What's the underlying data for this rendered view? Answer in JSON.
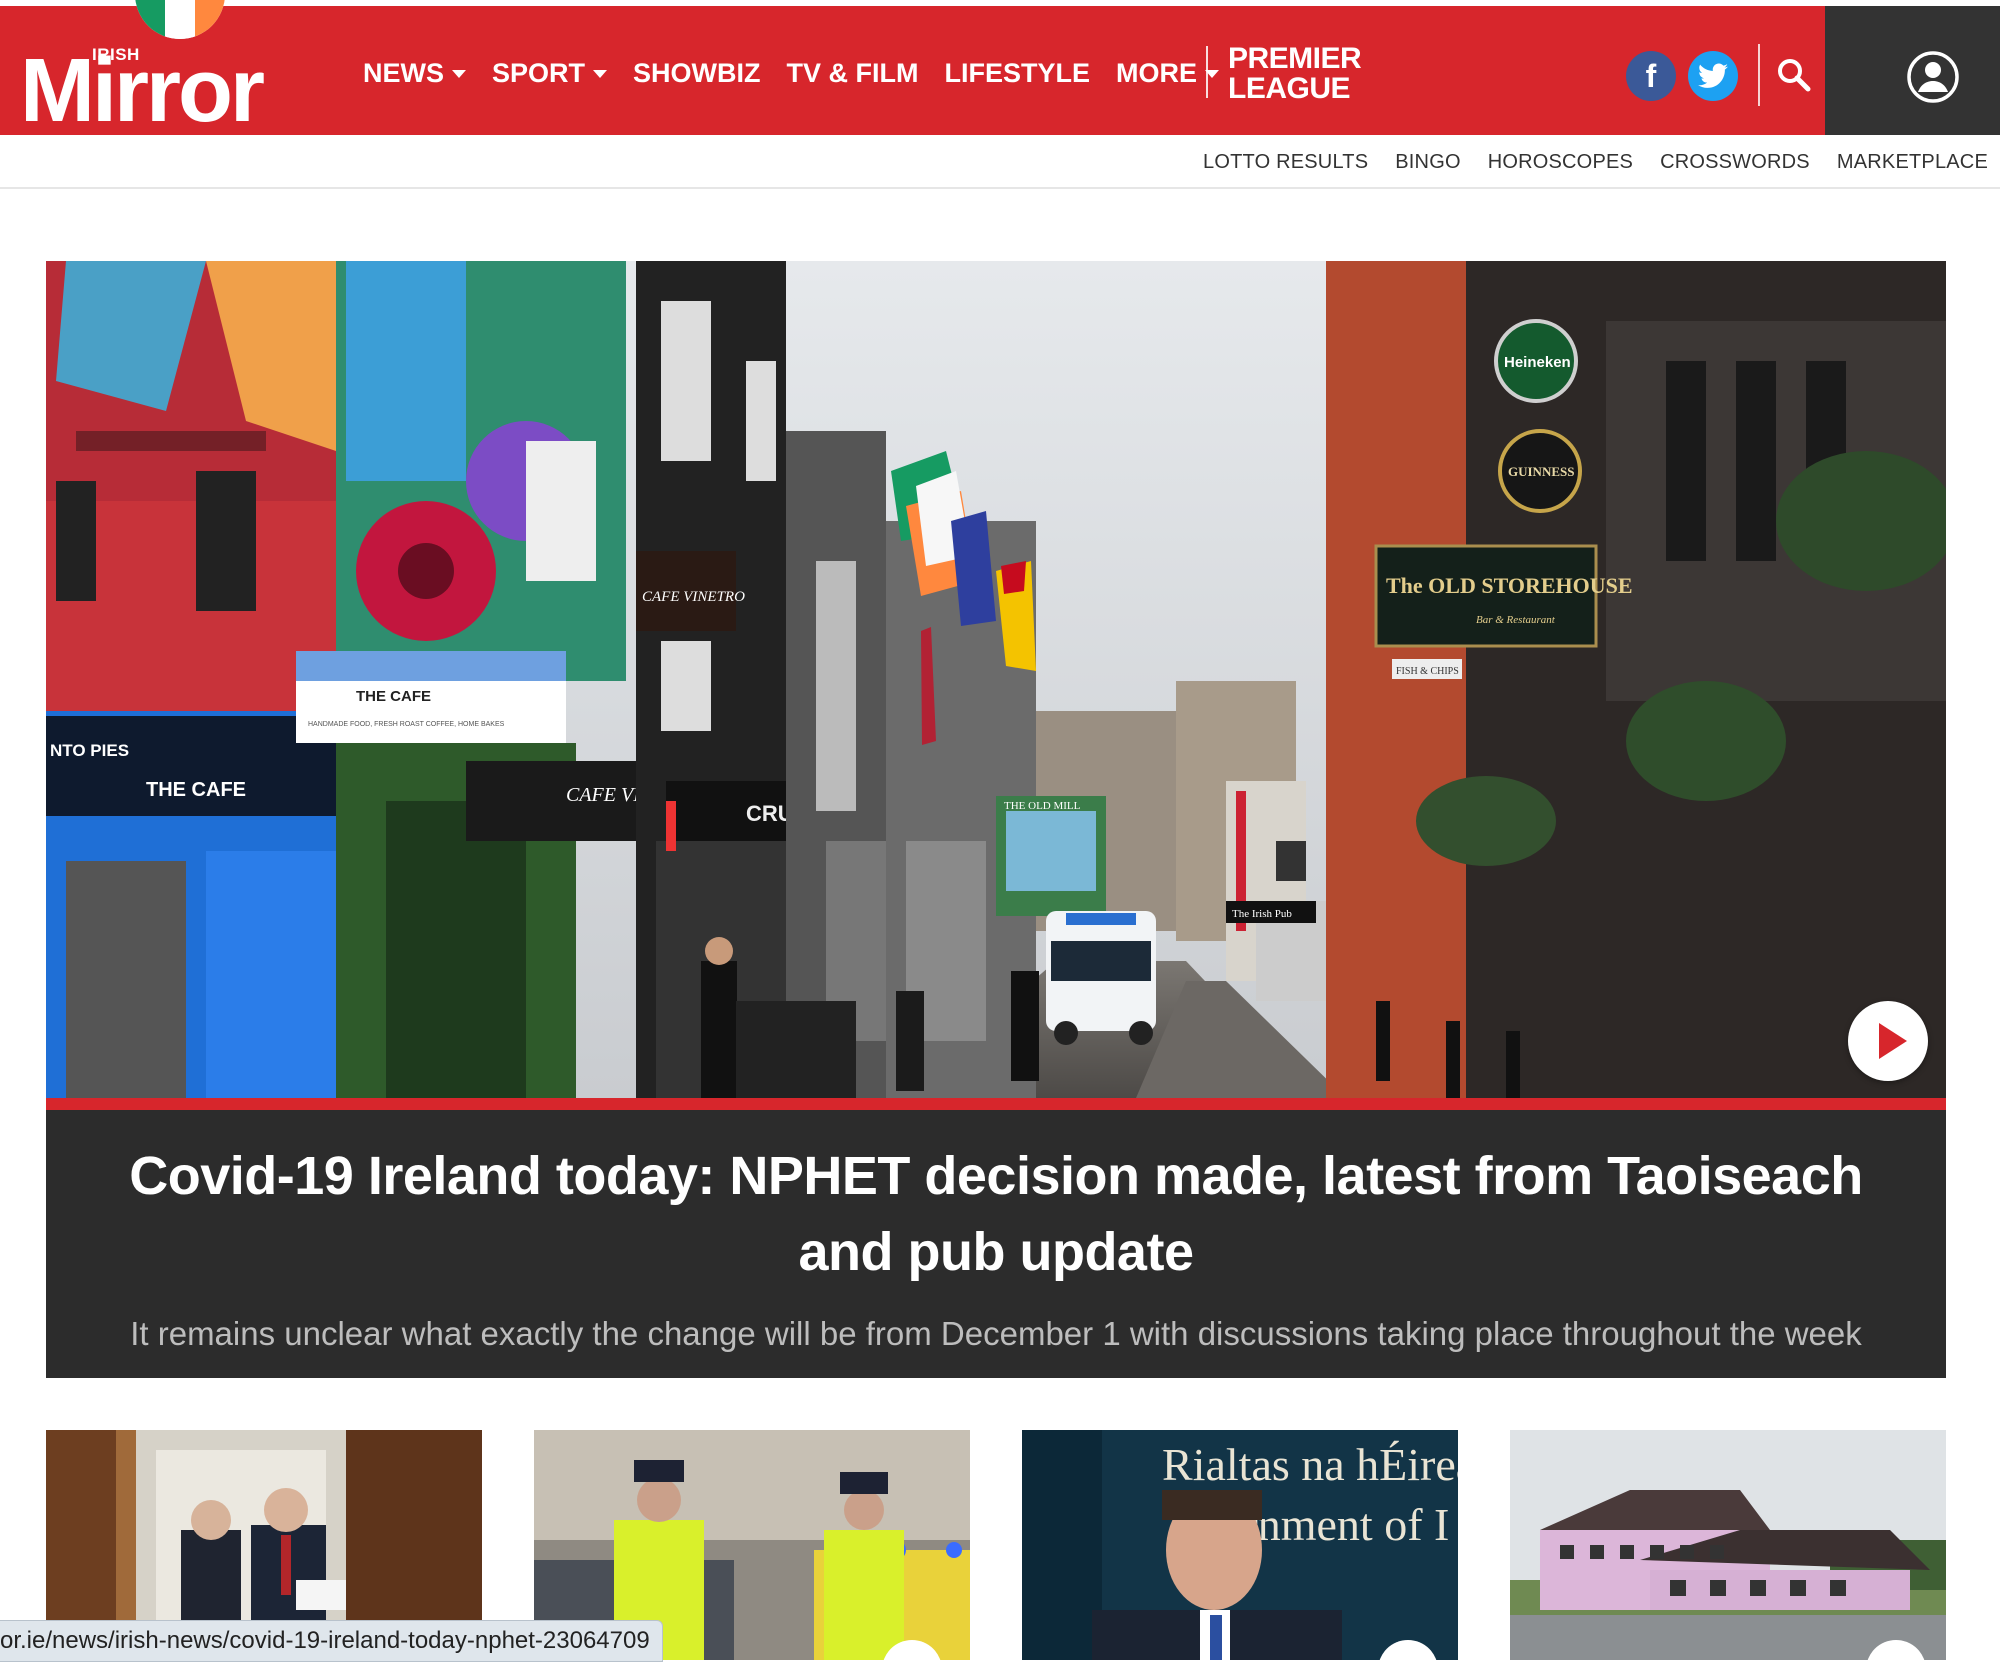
{
  "brand": {
    "small": "IRISH",
    "name": "Mirror",
    "flag_colors": [
      "#169b62",
      "#ffffff",
      "#ff883e"
    ],
    "accent": "#d7262c"
  },
  "nav": {
    "items": [
      {
        "label": "NEWS",
        "dropdown": true
      },
      {
        "label": "SPORT",
        "dropdown": true
      },
      {
        "label": "SHOWBIZ",
        "dropdown": false
      },
      {
        "label": "TV & FILM",
        "dropdown": false
      },
      {
        "label": "LIFESTYLE",
        "dropdown": false
      },
      {
        "label": "MORE",
        "dropdown": true
      }
    ],
    "premier_league_line1": "PREMIER",
    "premier_league_line2": "LEAGUE"
  },
  "social": {
    "facebook": "f",
    "twitter_icon": "twitter-bird-icon"
  },
  "icons": {
    "search": "search-icon",
    "account": "user-icon"
  },
  "subnav": [
    "LOTTO RESULTS",
    "BINGO",
    "HOROSCOPES",
    "CROSSWORDS",
    "MARKETPLACE"
  ],
  "hero": {
    "signs": {
      "cafe_left": "THE CAFE",
      "cafe_mid": "THE CAFE",
      "cafe_sub": "HANDMADE FOOD, FRESH ROAST COFFEE, HOME BAKES",
      "cafe_vinetro_1": "CAFE VINETRO",
      "cafe_vinetro_2": "CAFE VINETRO",
      "pies": "NTO PIES",
      "heineken": "Heineken",
      "guinness": "GUINNESS",
      "storehouse": "The OLD STOREHOUSE",
      "storehouse_sub": "Bar & Restaurant",
      "old_mill": "THE OLD MILL",
      "fish": "FISH & CHIPS",
      "irish_pub": "The Irish Pub",
      "cru": "CRU"
    },
    "headline": "Covid-19 Ireland today: NPHET decision made, latest from Taoiseach and pub update",
    "standfirst": "It remains unclear what exactly the change will be from December 1 with discussions taking place throughout the week"
  },
  "thumbs": [
    {
      "text": ""
    },
    {
      "text": ""
    },
    {
      "text": "Rialtas na hÉireann / Government of Ireland",
      "line1": "Rialtas na hÉirea",
      "line2": "ernment of I"
    },
    {
      "text": ""
    }
  ],
  "status_url": "or.ie/news/irish-news/covid-19-ireland-today-nphet-23064709"
}
